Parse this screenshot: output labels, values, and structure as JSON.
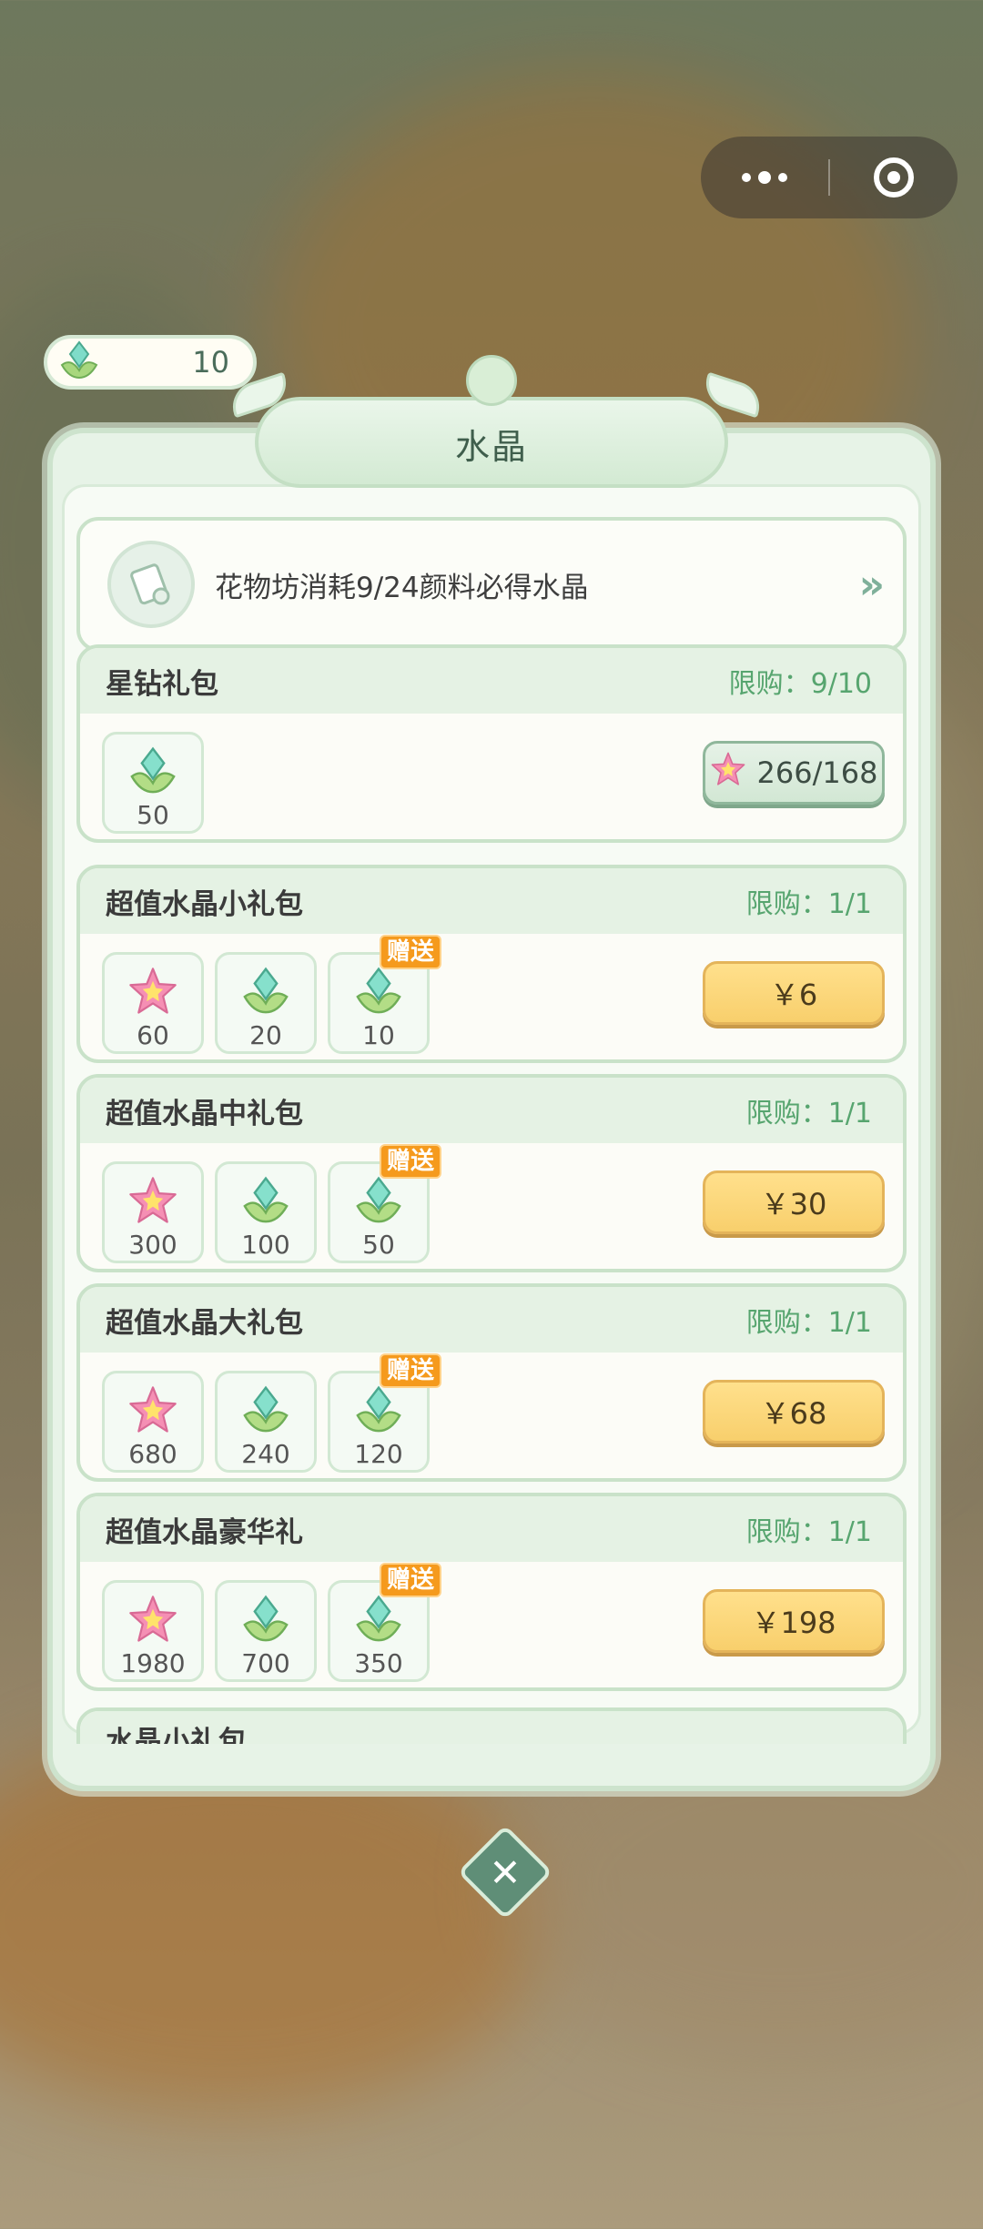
{
  "top_capsule": {
    "more_icon": "more-dots-icon",
    "close_icon": "target-circle-icon"
  },
  "currency": {
    "icon": "crystal-icon",
    "value": "10"
  },
  "panel": {
    "title": "水晶"
  },
  "banner": {
    "icon": "scroll-icon",
    "text": "花物坊消耗9/24颜料必得水晶",
    "arrow": "»"
  },
  "packs": [
    {
      "name": "星钻礼包",
      "limit": "限购：9/10",
      "items": [
        {
          "icon": "crystal-icon",
          "qty": "50",
          "gift": false
        }
      ],
      "price": "266/168",
      "price_icon": "star-icon",
      "price_type": "star"
    },
    {
      "name": "超值水晶小礼包",
      "limit": "限购：1/1",
      "items": [
        {
          "icon": "star-icon",
          "qty": "60",
          "gift": false
        },
        {
          "icon": "crystal-icon",
          "qty": "20",
          "gift": false
        },
        {
          "icon": "crystal-icon",
          "qty": "10",
          "gift": true
        }
      ],
      "price": "￥6",
      "price_type": "cash"
    },
    {
      "name": "超值水晶中礼包",
      "limit": "限购：1/1",
      "items": [
        {
          "icon": "star-icon",
          "qty": "300",
          "gift": false
        },
        {
          "icon": "crystal-icon",
          "qty": "100",
          "gift": false
        },
        {
          "icon": "crystal-icon",
          "qty": "50",
          "gift": true
        }
      ],
      "price": "￥30",
      "price_type": "cash"
    },
    {
      "name": "超值水晶大礼包",
      "limit": "限购：1/1",
      "items": [
        {
          "icon": "star-icon",
          "qty": "680",
          "gift": false
        },
        {
          "icon": "crystal-icon",
          "qty": "240",
          "gift": false
        },
        {
          "icon": "crystal-icon",
          "qty": "120",
          "gift": true
        }
      ],
      "price": "￥68",
      "price_type": "cash"
    },
    {
      "name": "超值水晶豪华礼",
      "limit": "限购：1/1",
      "items": [
        {
          "icon": "star-icon",
          "qty": "1980",
          "gift": false
        },
        {
          "icon": "crystal-icon",
          "qty": "700",
          "gift": false
        },
        {
          "icon": "crystal-icon",
          "qty": "350",
          "gift": true
        }
      ],
      "price": "￥198",
      "price_type": "cash"
    }
  ],
  "partial_pack": {
    "name": "水晶小礼包"
  },
  "gift_label": "赠送",
  "close_button": {
    "icon": "close-icon",
    "glyph": "✕"
  }
}
